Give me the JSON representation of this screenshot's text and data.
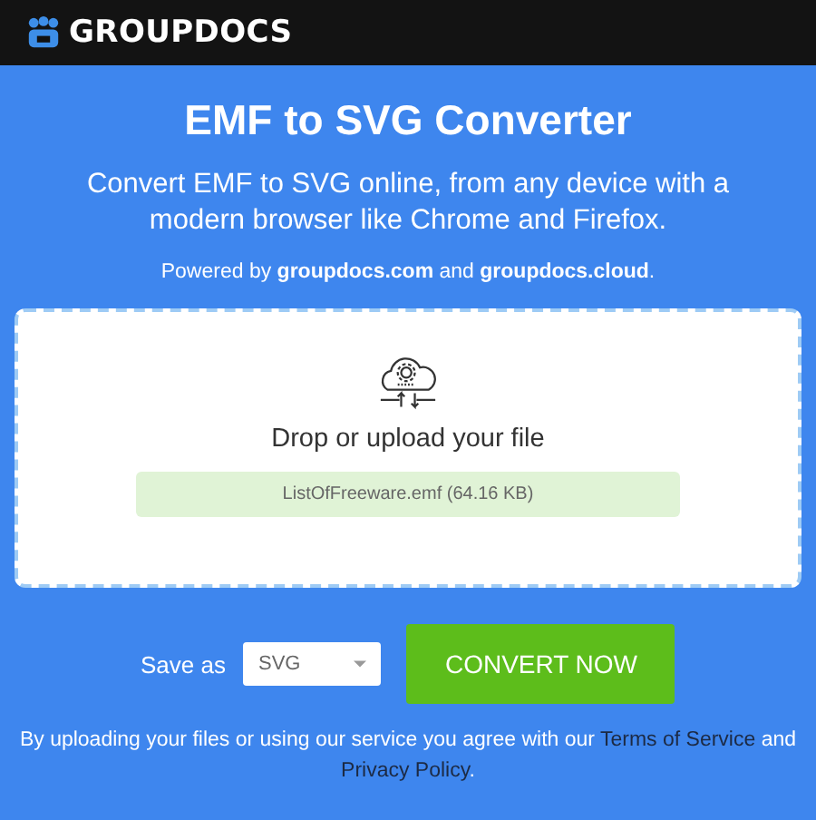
{
  "header": {
    "brand": "GROUPDOCS"
  },
  "title": "EMF to SVG Converter",
  "subtitle": "Convert EMF to SVG online, from any device with a modern browser like Chrome and Firefox.",
  "powered": {
    "prefix": "Powered by",
    "link1": "groupdocs.com",
    "joiner": "and",
    "link2": "groupdocs.cloud",
    "suffix": "."
  },
  "dropzone": {
    "label": "Drop or upload your file",
    "file": "ListOfFreeware.emf (64.16 KB)"
  },
  "save": {
    "label": "Save as",
    "format": "SVG",
    "button": "CONVERT NOW"
  },
  "legal": {
    "text": "By uploading your files or using our service you agree with our",
    "link1": "Terms of Service",
    "joiner": "and",
    "link2": "Privacy Policy",
    "suffix": "."
  }
}
